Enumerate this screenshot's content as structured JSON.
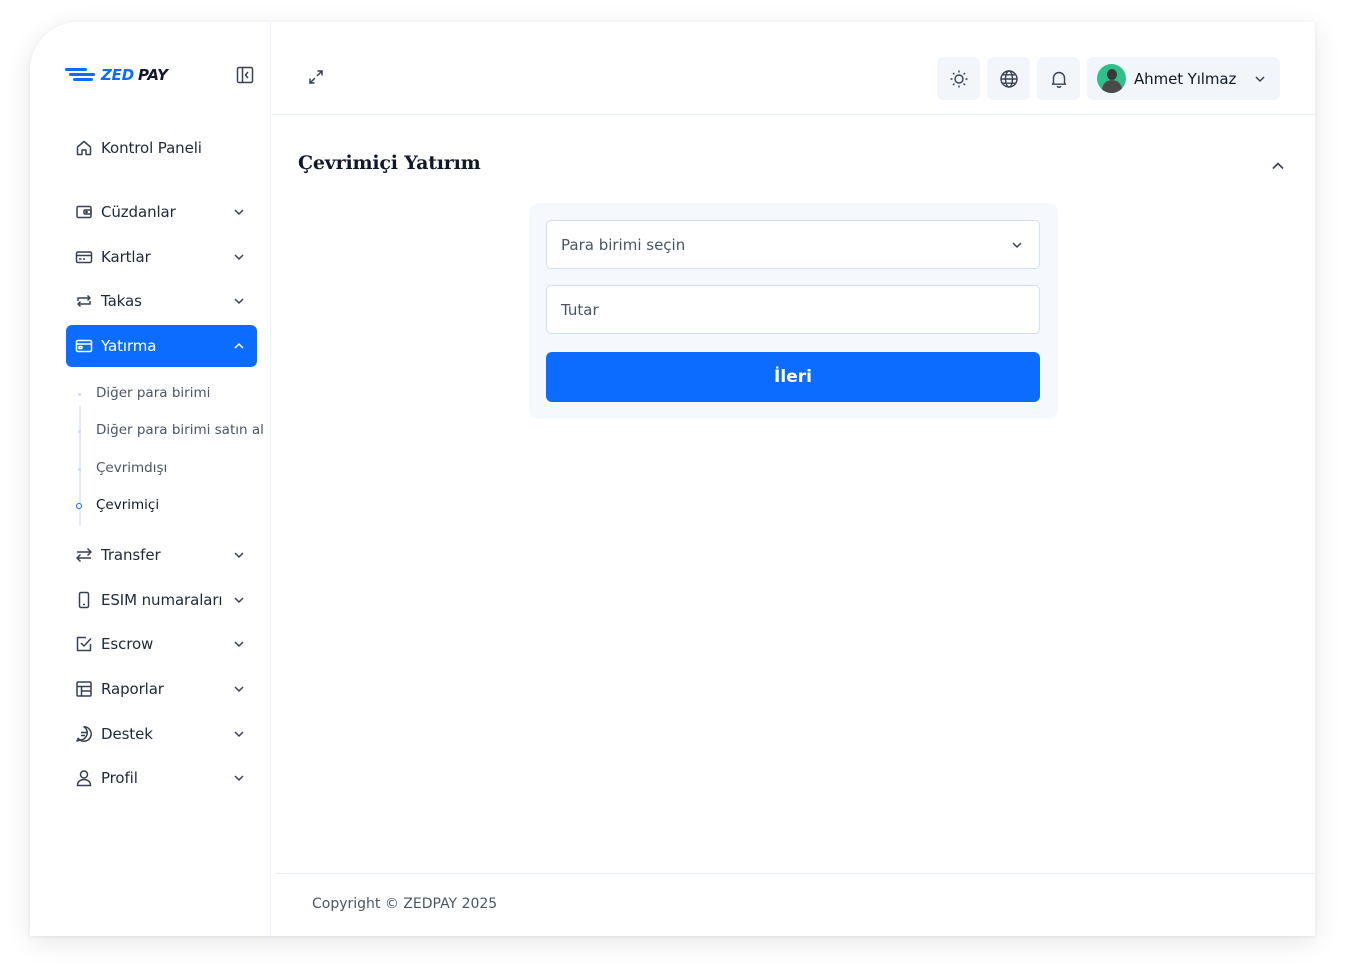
{
  "brand": {
    "name_part1": "ZED",
    "name_part2": "PAY"
  },
  "header": {
    "user_name": "Ahmet Yılmaz"
  },
  "sidebar": {
    "items": [
      {
        "label": "Kontrol Paneli",
        "icon": "home-icon"
      },
      {
        "label": "Cüzdanlar",
        "icon": "wallet-icon"
      },
      {
        "label": "Kartlar",
        "icon": "card-icon"
      },
      {
        "label": "Takas",
        "icon": "exchange-icon"
      },
      {
        "label": "Yatırma",
        "icon": "deposit-icon"
      },
      {
        "label": "Transfer",
        "icon": "transfer-icon"
      },
      {
        "label": "ESIM numaraları",
        "icon": "phone-icon"
      },
      {
        "label": "Escrow",
        "icon": "checkbox-icon"
      },
      {
        "label": "Raporlar",
        "icon": "table-icon"
      },
      {
        "label": "Destek",
        "icon": "chat-icon"
      },
      {
        "label": "Profil",
        "icon": "user-icon"
      }
    ],
    "deposit_sub": [
      {
        "label": "Diğer para birimi"
      },
      {
        "label": "Diğer para birimi satın al"
      },
      {
        "label": "Çevrimdışı"
      },
      {
        "label": "Çevrimiçi"
      }
    ]
  },
  "main": {
    "title": "Çevrimiçi Yatırım",
    "currency_select": {
      "placeholder": "Para birimi seçin"
    },
    "amount_input": {
      "placeholder": "Tutar"
    },
    "next_button": "İleri"
  },
  "footer": {
    "copyright": "Copyright © ZEDPAY 2025"
  },
  "colors": {
    "primary": "#0b6cff",
    "text": "#1f2937",
    "card_bg": "#f5f8fc"
  }
}
